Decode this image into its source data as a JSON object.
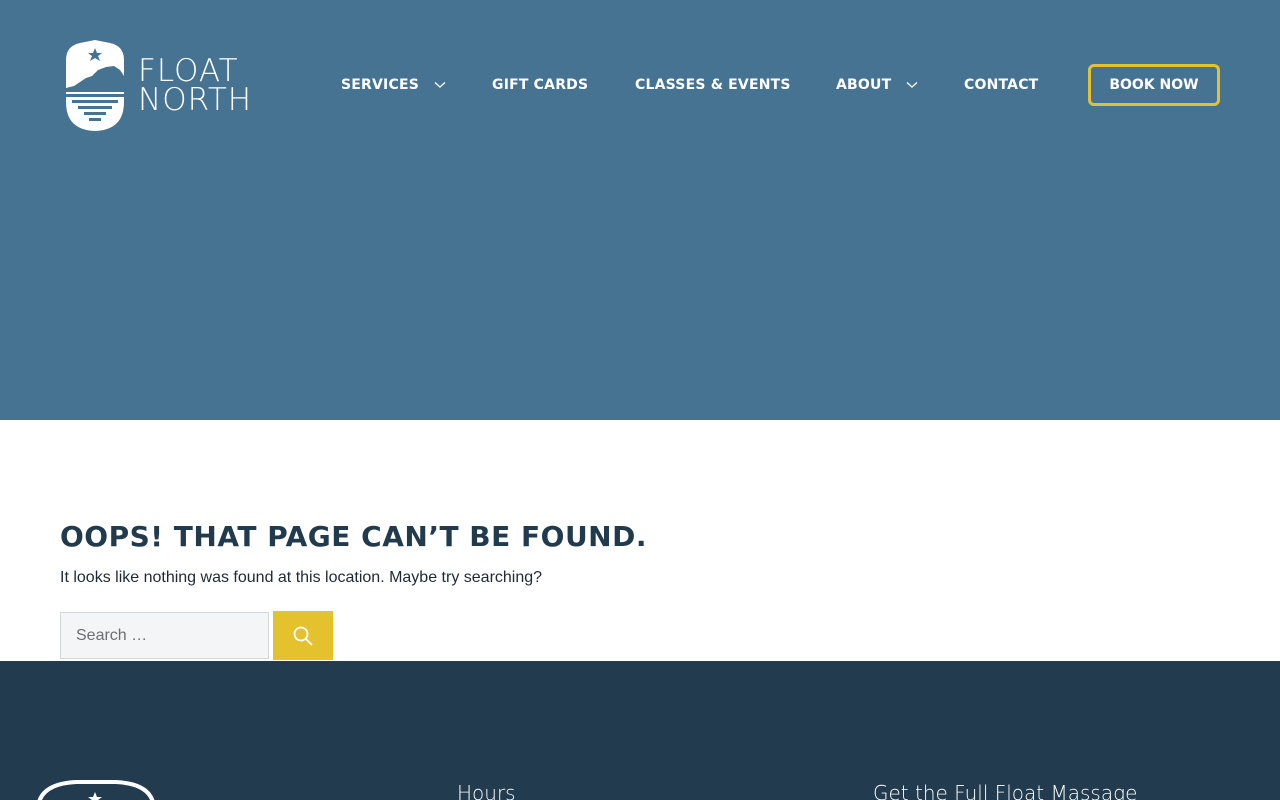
{
  "brand": {
    "line1": "FLOAT",
    "line2": "NORTH",
    "logo_icon": "float-north-logo"
  },
  "nav": {
    "items": [
      {
        "label": "SERVICES",
        "has_dropdown": true
      },
      {
        "label": "GIFT CARDS",
        "has_dropdown": false
      },
      {
        "label": "CLASSES & EVENTS",
        "has_dropdown": false
      },
      {
        "label": "ABOUT",
        "has_dropdown": true
      },
      {
        "label": "CONTACT",
        "has_dropdown": false
      }
    ],
    "cta_label": "BOOK NOW"
  },
  "main": {
    "title": "OOPS! THAT PAGE CAN’T BE FOUND.",
    "message": "It looks like nothing was found at this location. Maybe try searching?"
  },
  "search": {
    "placeholder": "Search …",
    "value": "",
    "button_icon": "search-icon"
  },
  "footer": {
    "hours_heading": "Hours",
    "massage_heading": "Get the Full Float Massage"
  },
  "colors": {
    "hero_bg": "#477392",
    "accent": "#e4c22e",
    "heading": "#213b4d",
    "footer_bg": "#223b4e"
  }
}
